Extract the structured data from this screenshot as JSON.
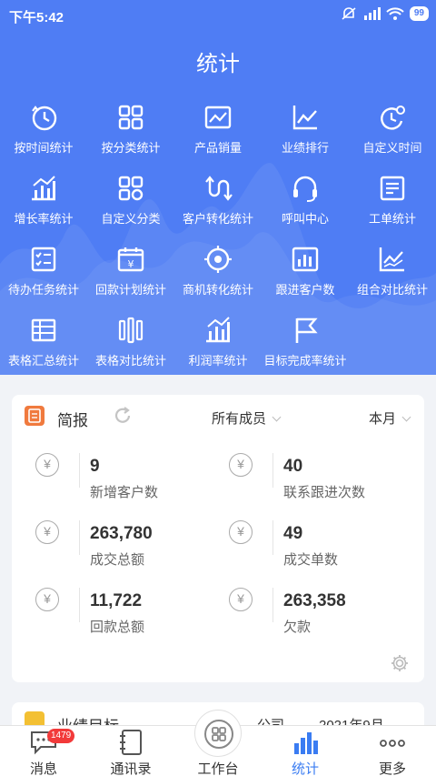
{
  "status": {
    "time": "下午5:42",
    "battery": "99"
  },
  "page": {
    "title": "统计"
  },
  "grid": [
    {
      "label": "按时间统计",
      "icon": "clock-icon"
    },
    {
      "label": "按分类统计",
      "icon": "category-grid-icon"
    },
    {
      "label": "产品销量",
      "icon": "image-chart-icon"
    },
    {
      "label": "业绩排行",
      "icon": "line-chart-icon"
    },
    {
      "label": "自定义时间",
      "icon": "clock-gear-icon"
    },
    {
      "label": "增长率统计",
      "icon": "growth-bars-icon"
    },
    {
      "label": "自定义分类",
      "icon": "grid-gear-icon"
    },
    {
      "label": "客户转化统计",
      "icon": "conversion-icon"
    },
    {
      "label": "呼叫中心",
      "icon": "headset-icon"
    },
    {
      "label": "工单统计",
      "icon": "ticket-doc-icon"
    },
    {
      "label": "待办任务统计",
      "icon": "todo-list-icon"
    },
    {
      "label": "回款计划统计",
      "icon": "calendar-yen-icon"
    },
    {
      "label": "商机转化统计",
      "icon": "target-icon"
    },
    {
      "label": "跟进客户数",
      "icon": "bar-board-icon"
    },
    {
      "label": "组合对比统计",
      "icon": "combo-chart-icon"
    },
    {
      "label": "表格汇总统计",
      "icon": "table-icon"
    },
    {
      "label": "表格对比统计",
      "icon": "compare-columns-icon"
    },
    {
      "label": "利润率统计",
      "icon": "profit-bars-icon"
    },
    {
      "label": "目标完成率统计",
      "icon": "flag-icon"
    }
  ],
  "report": {
    "title": "简报",
    "member_filter": "所有成员",
    "period_filter": "本月",
    "stats": [
      {
        "value": "9",
        "label": "新增客户数"
      },
      {
        "value": "40",
        "label": "联系跟进次数"
      },
      {
        "value": "263,780",
        "label": "成交总额"
      },
      {
        "value": "49",
        "label": "成交单数"
      },
      {
        "value": "11,722",
        "label": "回款总额"
      },
      {
        "value": "263,358",
        "label": "欠款"
      }
    ],
    "currency_symbol": "¥"
  },
  "target_card": {
    "title": "业绩目标",
    "scope": "公司",
    "date": "2021年9月"
  },
  "tabbar": {
    "messages": "消息",
    "messages_badge": "1479",
    "contacts": "通讯录",
    "workbench": "工作台",
    "stats": "统计",
    "more": "更多"
  },
  "colors": {
    "hero": "#4f7df4",
    "accent": "#3a7cf2",
    "report_icon": "#f07a3e",
    "badge": "#f23a3a"
  }
}
